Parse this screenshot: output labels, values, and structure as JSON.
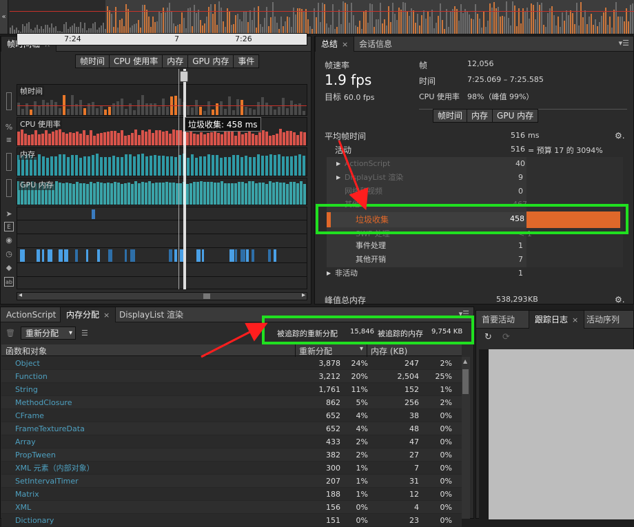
{
  "overview": {
    "collapse_glyph": "«"
  },
  "timeline": {
    "tab": "帧时间轴",
    "tab_close": "×",
    "menu_glyph": "▾☰",
    "buttons": [
      "帧时间",
      "CPU 使用率",
      "内存",
      "GPU 内存",
      "事件"
    ],
    "times": [
      "7:24",
      "7",
      "7:26"
    ],
    "rows": {
      "frame": "帧时间",
      "cpu": "CPU 使用率",
      "mem": "内存",
      "gpu": "GPU 内存"
    },
    "percent": "%",
    "tooltip": "垃圾收集: 458 ms",
    "scroll_left": "◂",
    "scroll_right": "▸",
    "side_icons": [
      "cursor-icon",
      "event-icon",
      "globe-icon",
      "timer-icon",
      "bucket-icon",
      "abc-icon"
    ],
    "accent": "#e8772a",
    "cpu_color": "#d9534a",
    "mem_color": "#2f9aa6",
    "gpu_color": "#3aa3a8"
  },
  "summary": {
    "tabs": [
      "总结",
      "会话信息"
    ],
    "tab_close": "×",
    "menu_glyph": "▾☰",
    "frame_rate_label": "帧速率",
    "frame_rate": "1.9 fps",
    "target_label": "目标",
    "target_value": "60.0 fps",
    "frames_label": "帧",
    "frames": "12,056",
    "time_label": "时间",
    "time": "7:25.069 – 7:25.585",
    "cpu_label": "CPU 使用率",
    "cpu": "98%（峰值 99%）",
    "buttons": [
      "帧时间",
      "内存",
      "GPU 内存"
    ],
    "avg_label": "平均帧时间",
    "avg_value": "516",
    "avg_unit": "ms",
    "active_label": "活动",
    "active_value": "516",
    "active_note": "= 预算 17 的 3094%",
    "expand_glyph": "▶",
    "rows": [
      {
        "name": "ActionScript",
        "value": "40"
      },
      {
        "name": "DisplayList 渲染",
        "value": "9"
      },
      {
        "name": "网络和视频",
        "value": "0"
      },
      {
        "name": "其他",
        "value": "467"
      }
    ],
    "gc_label": "垃圾收集",
    "gc_value": "458",
    "subrows": [
      {
        "name": "SWF 处理",
        "value": "< 1"
      },
      {
        "name": "事件处理",
        "value": "1"
      },
      {
        "name": "其他开销",
        "value": "7"
      }
    ],
    "inactive_label": "非活动",
    "inactive_value": "1",
    "peak_label": "峰值总内存",
    "peak_value": "538,293",
    "peak_unit": "KB",
    "gear_glyph": "⚙."
  },
  "memory": {
    "tabs": [
      "ActionScript",
      "内存分配",
      "DisplayList 渲染"
    ],
    "tab_close": "×",
    "menu_glyph": "▾☰",
    "trash_glyph": "🗑",
    "list_glyph": "☰",
    "mode": "重新分配",
    "tracked_realloc_label": "被追踪的重新分配",
    "tracked_realloc": "15,846",
    "tracked_mem_label": "被追踪的内存",
    "tracked_mem": "9,754 KB",
    "headers": [
      "函数和对象",
      "重新分配",
      "内存 (KB)"
    ],
    "sort_glyph": "▾",
    "rows": [
      [
        "Object",
        "3,878",
        "24%",
        "247",
        "2%"
      ],
      [
        "Function",
        "3,212",
        "20%",
        "2,504",
        "25%"
      ],
      [
        "String",
        "1,761",
        "11%",
        "152",
        "1%"
      ],
      [
        "MethodClosure",
        "862",
        "5%",
        "256",
        "2%"
      ],
      [
        "CFrame",
        "652",
        "4%",
        "38",
        "0%"
      ],
      [
        "FrameTextureData",
        "652",
        "4%",
        "48",
        "0%"
      ],
      [
        "Array",
        "433",
        "2%",
        "47",
        "0%"
      ],
      [
        "PropTween",
        "382",
        "2%",
        "27",
        "0%"
      ],
      [
        "XML 元素（内部对象）",
        "300",
        "1%",
        "7",
        "0%"
      ],
      [
        "SetIntervalTimer",
        "207",
        "1%",
        "31",
        "0%"
      ],
      [
        "Matrix",
        "188",
        "1%",
        "12",
        "0%"
      ],
      [
        "XML",
        "156",
        "0%",
        "4",
        "0%"
      ],
      [
        "Dictionary",
        "151",
        "0%",
        "23",
        "0%"
      ]
    ]
  },
  "trace": {
    "tabs": [
      "首要活动",
      "跟踪日志",
      "活动序列"
    ],
    "tab_close": "×",
    "refresh_glyph": "↻",
    "reload_glyph": "⟳"
  }
}
